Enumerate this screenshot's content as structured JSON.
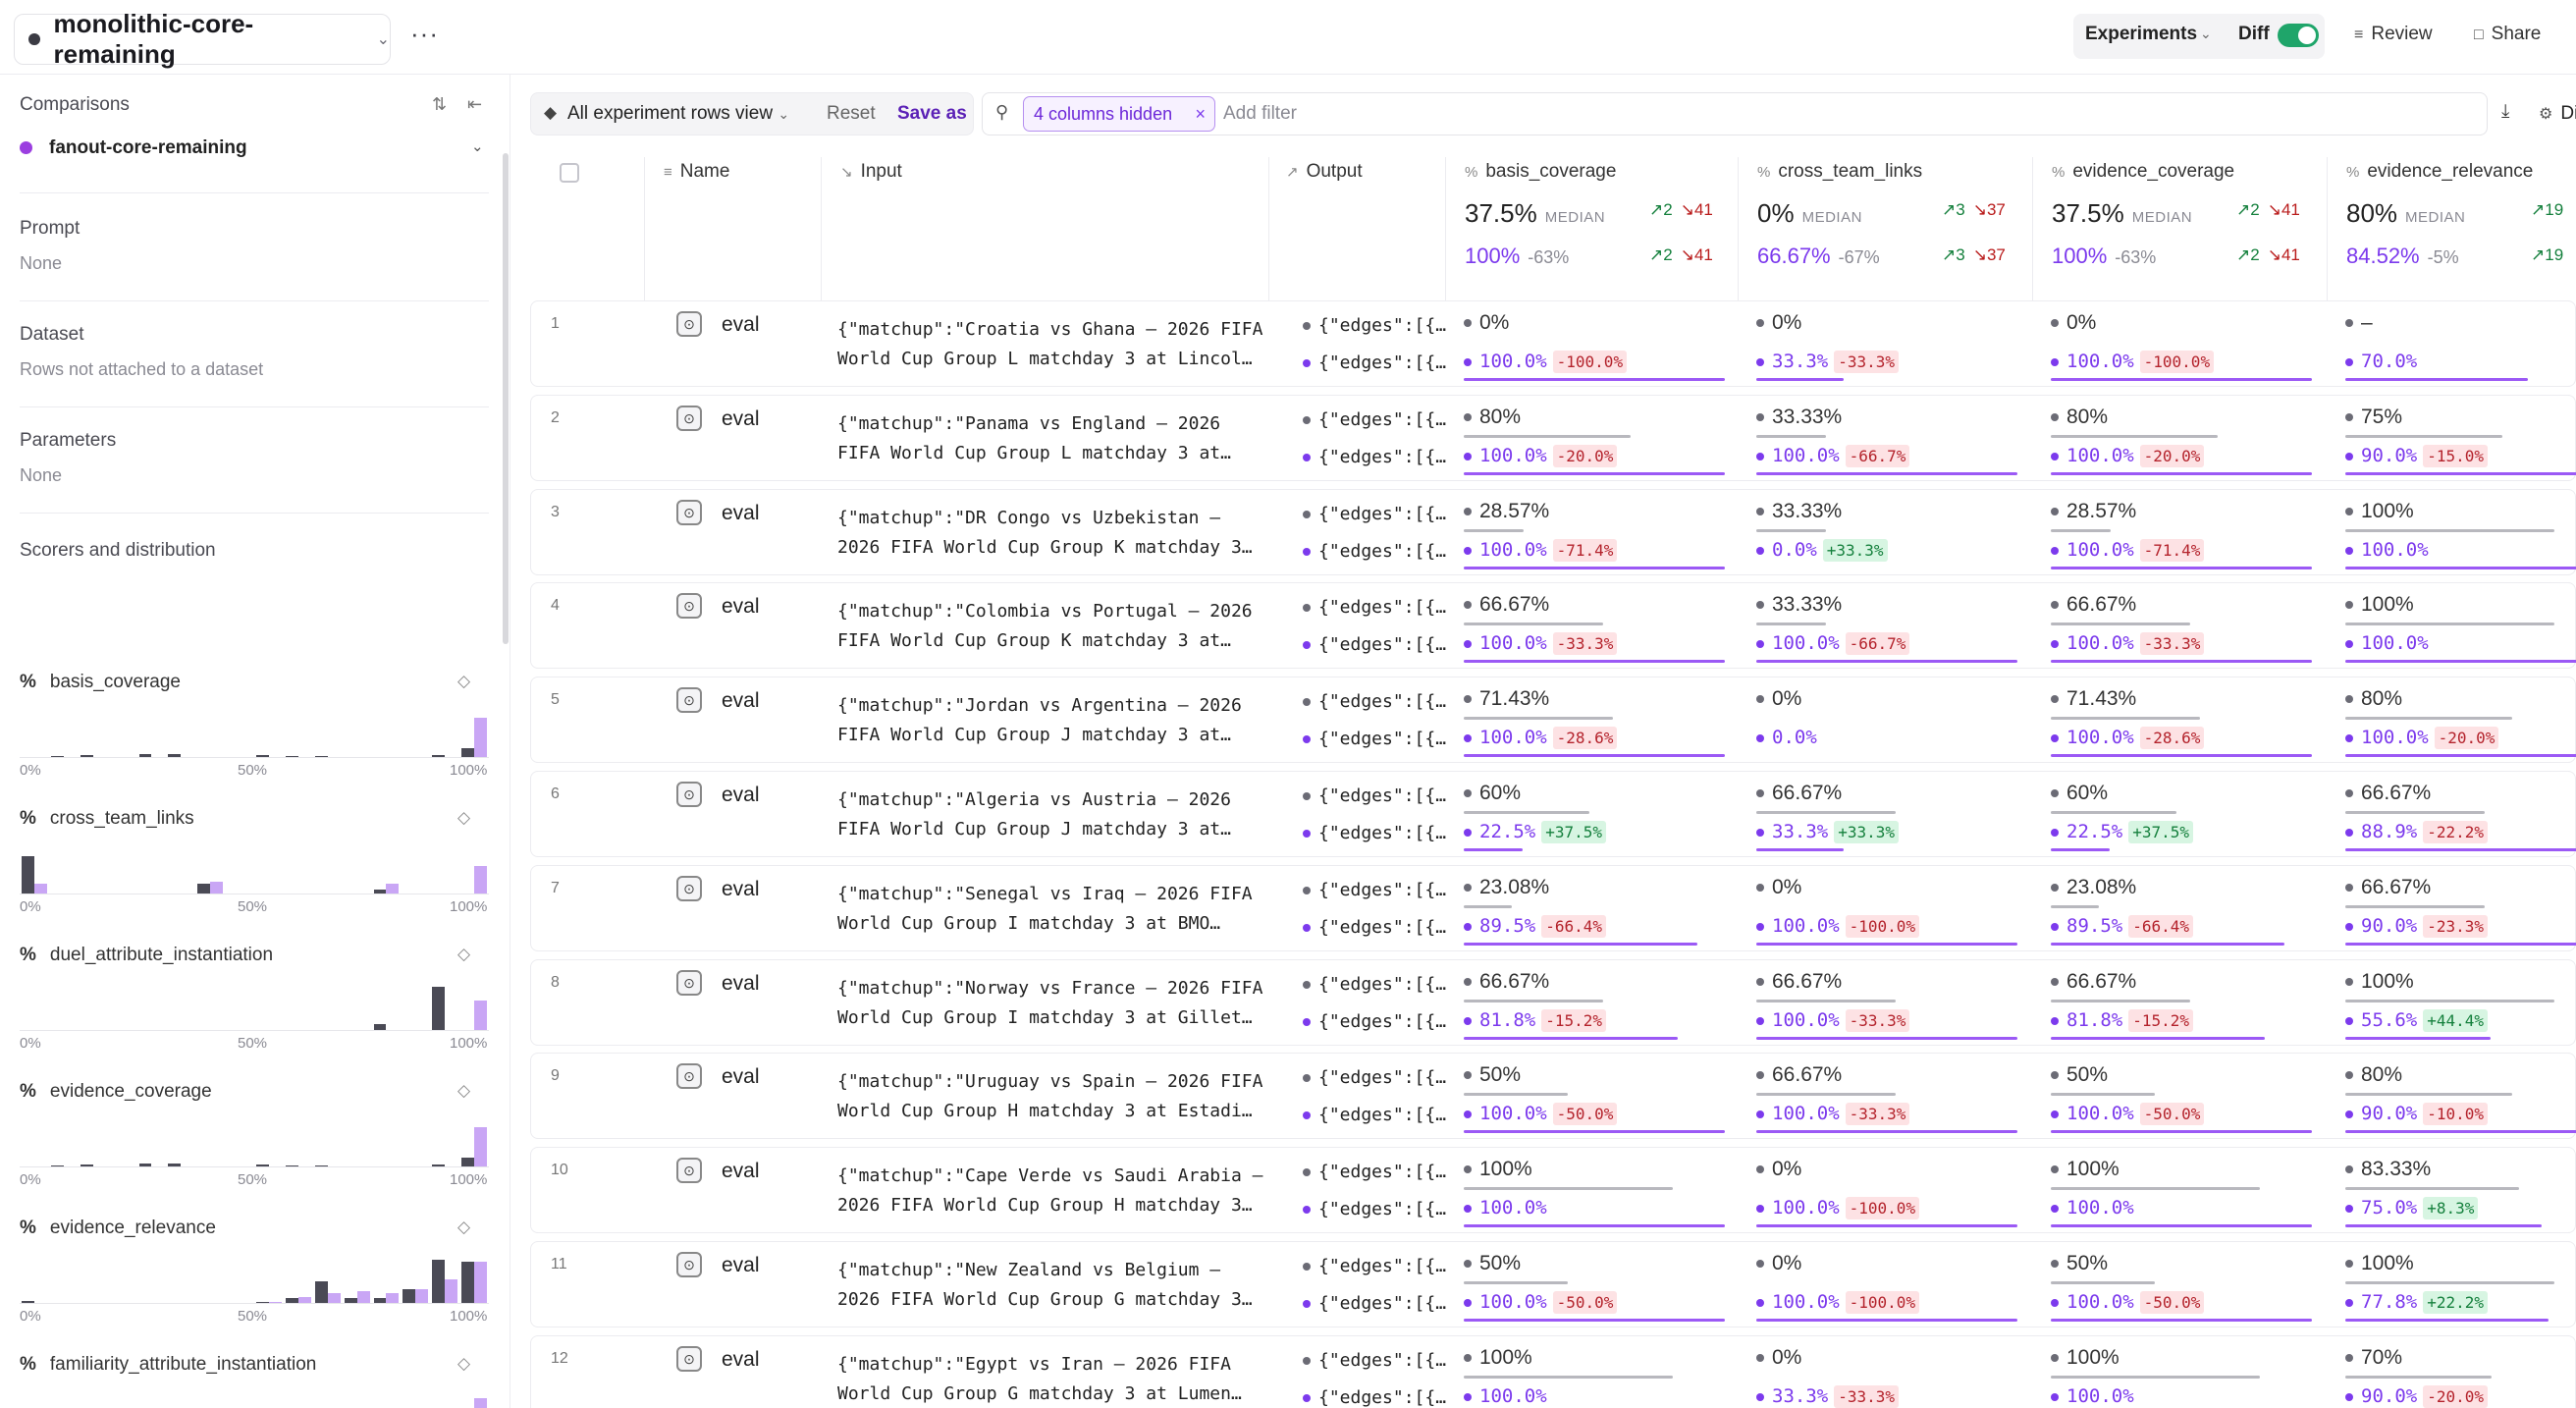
{
  "topbar": {
    "project": "monolithic-core-remaining",
    "experiments_label": "Experiments",
    "diff_label": "Diff",
    "review_label": "Review",
    "share_label": "Share"
  },
  "sidebar": {
    "comparisons_label": "Comparisons",
    "comparison_name": "fanout-core-remaining",
    "prompt_label": "Prompt",
    "prompt_value": "None",
    "dataset_label": "Dataset",
    "dataset_value": "Rows not attached to a dataset",
    "parameters_label": "Parameters",
    "parameters_value": "None",
    "scorers_label": "Scorers and distribution",
    "axis": [
      "0%",
      "50%",
      "100%"
    ],
    "scorers": [
      {
        "name": "basis_coverage",
        "gray": [
          0,
          1,
          2,
          0,
          3,
          3,
          0,
          0,
          2,
          1,
          1,
          0,
          0,
          0,
          2,
          9
        ],
        "purple": [
          0,
          0,
          0,
          0,
          0,
          0,
          0,
          0,
          0,
          0,
          0,
          0,
          0,
          0,
          0,
          40
        ]
      },
      {
        "name": "cross_team_links",
        "gray": [
          38,
          0,
          0,
          0,
          0,
          0,
          10,
          0,
          0,
          0,
          0,
          0,
          4,
          0,
          0,
          0
        ],
        "purple": [
          10,
          0,
          0,
          0,
          0,
          0,
          12,
          0,
          0,
          0,
          0,
          0,
          10,
          0,
          0,
          28
        ]
      },
      {
        "name": "duel_attribute_instantiation",
        "gray": [
          0,
          0,
          0,
          0,
          0,
          0,
          0,
          0,
          0,
          0,
          0,
          0,
          6,
          0,
          44,
          0
        ],
        "purple": [
          0,
          0,
          0,
          0,
          0,
          0,
          0,
          0,
          0,
          0,
          0,
          0,
          0,
          0,
          0,
          30
        ]
      },
      {
        "name": "evidence_coverage",
        "gray": [
          0,
          1,
          2,
          0,
          3,
          3,
          0,
          0,
          2,
          1,
          1,
          0,
          0,
          0,
          2,
          9
        ],
        "purple": [
          0,
          0,
          0,
          0,
          0,
          0,
          0,
          0,
          0,
          0,
          0,
          0,
          0,
          0,
          0,
          40
        ]
      },
      {
        "name": "evidence_relevance",
        "gray": [
          2,
          0,
          0,
          0,
          0,
          0,
          0,
          0,
          1,
          5,
          22,
          5,
          5,
          14,
          44,
          42
        ],
        "purple": [
          0,
          0,
          0,
          0,
          0,
          0,
          0,
          0,
          1,
          6,
          10,
          12,
          10,
          14,
          24,
          42
        ]
      },
      {
        "name": "familiarity_attribute_instantiation",
        "gray": [
          0,
          0,
          0,
          0,
          0,
          0,
          0,
          0,
          0,
          0,
          0,
          0,
          0,
          0,
          10,
          0
        ],
        "purple": [
          0,
          0,
          0,
          0,
          0,
          0,
          0,
          0,
          0,
          0,
          0,
          0,
          0,
          0,
          0,
          42
        ]
      }
    ]
  },
  "toolbar": {
    "view_label": "All experiment rows view",
    "reset_label": "Reset",
    "save_label": "Save as",
    "chip_label": "4 columns hidden",
    "filter_placeholder": "Add filter",
    "display_label": "Display"
  },
  "columns": {
    "name": "Name",
    "input": "Input",
    "output": "Output",
    "median_label": "MEDIAN",
    "metrics": [
      {
        "name": "basis_coverage",
        "median": "37.5%",
        "up": "2",
        "down": "41",
        "cmp": "100%",
        "diff": "-63%",
        "up2": "2",
        "down2": "41"
      },
      {
        "name": "cross_team_links",
        "median": "0%",
        "up": "3",
        "down": "37",
        "cmp": "66.67%",
        "diff": "-67%",
        "up2": "3",
        "down2": "37"
      },
      {
        "name": "evidence_coverage",
        "median": "37.5%",
        "up": "2",
        "down": "41",
        "cmp": "100%",
        "diff": "-63%",
        "up2": "2",
        "down2": "41"
      },
      {
        "name": "evidence_relevance",
        "median": "80%",
        "up": "19",
        "down": "",
        "cmp": "84.52%",
        "diff": "-5%",
        "up2": "19",
        "down2": ""
      }
    ]
  },
  "rows": [
    {
      "n": "1",
      "name": "eval",
      "in1": "{\"matchup\":\"Croatia vs Ghana – 2026 FIFA",
      "in2": "World Cup Group L matchday 3 at Lincol…",
      "out": "{\"edges\":[{…",
      "cells": [
        [
          "0%",
          "100.0%",
          "-100.0%",
          0,
          1.0
        ],
        [
          "0%",
          "33.3%",
          "-33.3%",
          0,
          0.333
        ],
        [
          "0%",
          "100.0%",
          "-100.0%",
          0,
          1.0
        ],
        [
          "–",
          "70.0%",
          "",
          0,
          0.7
        ]
      ]
    },
    {
      "n": "2",
      "name": "eval",
      "in1": "{\"matchup\":\"Panama vs England – 2026",
      "in2": "FIFA World Cup Group L matchday 3 at…",
      "out": "{\"edges\":[{…",
      "cells": [
        [
          "80%",
          "100.0%",
          "-20.0%",
          0.8,
          1.0
        ],
        [
          "33.33%",
          "100.0%",
          "-66.7%",
          0.333,
          1.0
        ],
        [
          "80%",
          "100.0%",
          "-20.0%",
          0.8,
          1.0
        ],
        [
          "75%",
          "90.0%",
          "-15.0%",
          0.75,
          0.9
        ]
      ]
    },
    {
      "n": "3",
      "name": "eval",
      "in1": "{\"matchup\":\"DR Congo vs Uzbekistan –",
      "in2": "2026 FIFA World Cup Group K matchday 3…",
      "out": "{\"edges\":[{…",
      "cells": [
        [
          "28.57%",
          "100.0%",
          "-71.4%",
          0.286,
          1.0
        ],
        [
          "33.33%",
          "0.0%",
          "+33.3%",
          0.333,
          0
        ],
        [
          "28.57%",
          "100.0%",
          "-71.4%",
          0.286,
          1.0
        ],
        [
          "100%",
          "100.0%",
          "",
          1.0,
          1.0
        ]
      ]
    },
    {
      "n": "4",
      "name": "eval",
      "in1": "{\"matchup\":\"Colombia vs Portugal – 2026",
      "in2": "FIFA World Cup Group K matchday 3 at…",
      "out": "{\"edges\":[{…",
      "cells": [
        [
          "66.67%",
          "100.0%",
          "-33.3%",
          0.667,
          1.0
        ],
        [
          "33.33%",
          "100.0%",
          "-66.7%",
          0.333,
          1.0
        ],
        [
          "66.67%",
          "100.0%",
          "-33.3%",
          0.667,
          1.0
        ],
        [
          "100%",
          "100.0%",
          "",
          1.0,
          1.0
        ]
      ]
    },
    {
      "n": "5",
      "name": "eval",
      "in1": "{\"matchup\":\"Jordan vs Argentina – 2026",
      "in2": "FIFA World Cup Group J matchday 3 at…",
      "out": "{\"edges\":[{…",
      "cells": [
        [
          "71.43%",
          "100.0%",
          "-28.6%",
          0.714,
          1.0
        ],
        [
          "0%",
          "0.0%",
          "",
          0,
          0
        ],
        [
          "71.43%",
          "100.0%",
          "-28.6%",
          0.714,
          1.0
        ],
        [
          "80%",
          "100.0%",
          "-20.0%",
          0.8,
          1.0
        ]
      ]
    },
    {
      "n": "6",
      "name": "eval",
      "in1": "{\"matchup\":\"Algeria vs Austria – 2026",
      "in2": "FIFA World Cup Group J matchday 3 at…",
      "out": "{\"edges\":[{…",
      "cells": [
        [
          "60%",
          "22.5%",
          "+37.5%",
          0.6,
          0.225
        ],
        [
          "66.67%",
          "33.3%",
          "+33.3%",
          0.667,
          0.333
        ],
        [
          "60%",
          "22.5%",
          "+37.5%",
          0.6,
          0.225
        ],
        [
          "66.67%",
          "88.9%",
          "-22.2%",
          0.667,
          0.889
        ]
      ]
    },
    {
      "n": "7",
      "name": "eval",
      "in1": "{\"matchup\":\"Senegal vs Iraq – 2026 FIFA",
      "in2": "World Cup Group I matchday 3 at BMO…",
      "out": "{\"edges\":[{…",
      "cells": [
        [
          "23.08%",
          "89.5%",
          "-66.4%",
          0.231,
          0.895
        ],
        [
          "0%",
          "100.0%",
          "-100.0%",
          0,
          1.0
        ],
        [
          "23.08%",
          "89.5%",
          "-66.4%",
          0.231,
          0.895
        ],
        [
          "66.67%",
          "90.0%",
          "-23.3%",
          0.667,
          0.9
        ]
      ]
    },
    {
      "n": "8",
      "name": "eval",
      "in1": "{\"matchup\":\"Norway vs France – 2026 FIFA",
      "in2": "World Cup Group I matchday 3 at Gillet…",
      "out": "{\"edges\":[{…",
      "cells": [
        [
          "66.67%",
          "81.8%",
          "-15.2%",
          0.667,
          0.818
        ],
        [
          "66.67%",
          "100.0%",
          "-33.3%",
          0.667,
          1.0
        ],
        [
          "66.67%",
          "81.8%",
          "-15.2%",
          0.667,
          0.818
        ],
        [
          "100%",
          "55.6%",
          "+44.4%",
          1.0,
          0.556
        ]
      ]
    },
    {
      "n": "9",
      "name": "eval",
      "in1": "{\"matchup\":\"Uruguay vs Spain – 2026 FIFA",
      "in2": "World Cup Group H matchday 3 at Estadi…",
      "out": "{\"edges\":[{…",
      "cells": [
        [
          "50%",
          "100.0%",
          "-50.0%",
          0.5,
          1.0
        ],
        [
          "66.67%",
          "100.0%",
          "-33.3%",
          0.667,
          1.0
        ],
        [
          "50%",
          "100.0%",
          "-50.0%",
          0.5,
          1.0
        ],
        [
          "80%",
          "90.0%",
          "-10.0%",
          0.8,
          0.9
        ]
      ]
    },
    {
      "n": "10",
      "name": "eval",
      "in1": "{\"matchup\":\"Cape Verde vs Saudi Arabia –",
      "in2": "2026 FIFA World Cup Group H matchday 3…",
      "out": "{\"edges\":[{…",
      "cells": [
        [
          "100%",
          "100.0%",
          "",
          1.0,
          1.0
        ],
        [
          "0%",
          "100.0%",
          "-100.0%",
          0,
          1.0
        ],
        [
          "100%",
          "100.0%",
          "",
          1.0,
          1.0
        ],
        [
          "83.33%",
          "75.0%",
          "+8.3%",
          0.833,
          0.75
        ]
      ]
    },
    {
      "n": "11",
      "name": "eval",
      "in1": "{\"matchup\":\"New Zealand vs Belgium –",
      "in2": "2026 FIFA World Cup Group G matchday 3…",
      "out": "{\"edges\":[{…",
      "cells": [
        [
          "50%",
          "100.0%",
          "-50.0%",
          0.5,
          1.0
        ],
        [
          "0%",
          "100.0%",
          "-100.0%",
          0,
          1.0
        ],
        [
          "50%",
          "100.0%",
          "-50.0%",
          0.5,
          1.0
        ],
        [
          "100%",
          "77.8%",
          "+22.2%",
          1.0,
          0.778
        ]
      ]
    },
    {
      "n": "12",
      "name": "eval",
      "in1": "{\"matchup\":\"Egypt vs Iran – 2026 FIFA",
      "in2": "World Cup Group G matchday 3 at Lumen…",
      "out": "{\"edges\":[{…",
      "cells": [
        [
          "100%",
          "100.0%",
          "",
          1.0,
          1.0
        ],
        [
          "0%",
          "33.3%",
          "-33.3%",
          0,
          0.333
        ],
        [
          "100%",
          "100.0%",
          "",
          1.0,
          1.0
        ],
        [
          "70%",
          "90.0%",
          "-20.0%",
          0.7,
          0.9
        ]
      ]
    }
  ]
}
